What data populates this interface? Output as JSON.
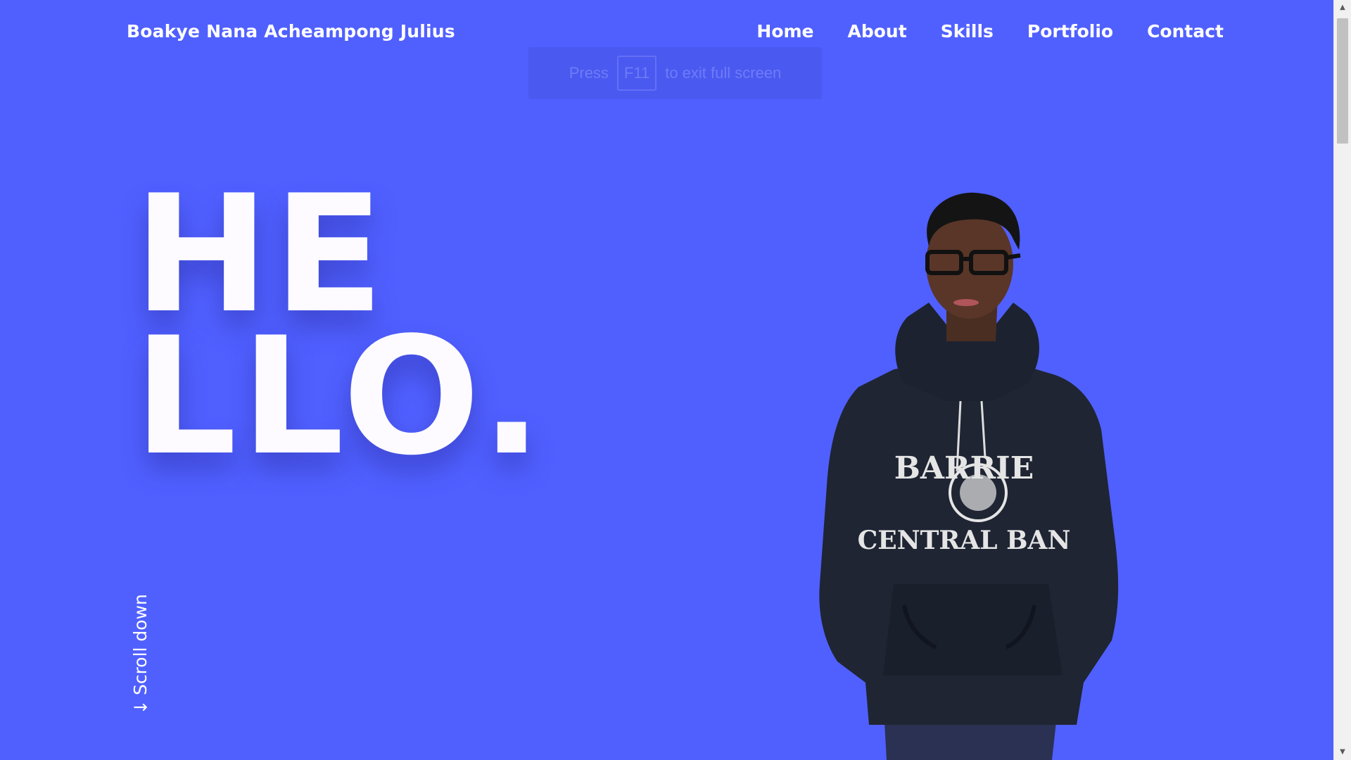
{
  "header": {
    "brand": "Boakye Nana Acheampong Julius",
    "nav": [
      {
        "label": "Home",
        "active": true
      },
      {
        "label": "About",
        "active": false
      },
      {
        "label": "Skills",
        "active": false
      },
      {
        "label": "Portfolio",
        "active": false
      },
      {
        "label": "Contact",
        "active": false
      }
    ]
  },
  "fullscreen_toast": {
    "prefix": "Press",
    "key": "F11",
    "suffix": "to exit full screen"
  },
  "hero": {
    "line1": "HE",
    "line2": "LLO."
  },
  "scroll_down": {
    "label": "Scroll down",
    "icon": "arrow-down-icon"
  },
  "portrait": {
    "hoodie_text_top": "BARRIE",
    "hoodie_text_bottom": "CENTRAL BAN"
  },
  "colors": {
    "background": "#5060ff",
    "text": "#ffffff"
  }
}
